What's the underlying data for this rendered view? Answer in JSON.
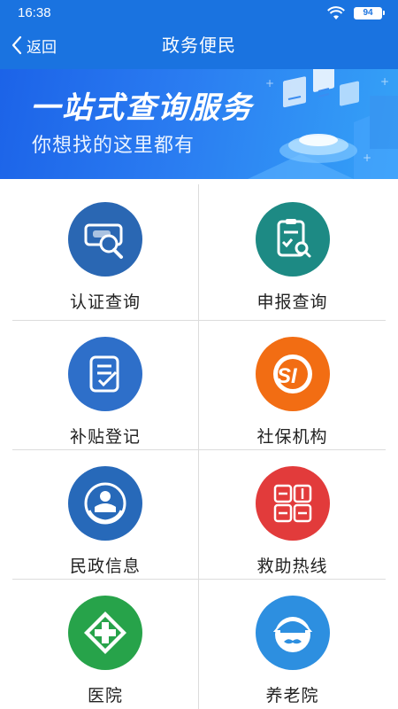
{
  "status_bar": {
    "time": "16:38",
    "battery": "94"
  },
  "nav": {
    "back_label": "返回",
    "title": "政务便民"
  },
  "banner": {
    "title": "一站式查询服务",
    "subtitle": "你想找的这里都有"
  },
  "services": [
    {
      "label": "认证查询",
      "icon": "search-id-icon",
      "color": "#2a67b3"
    },
    {
      "label": "申报查询",
      "icon": "clipboard-search-icon",
      "color": "#1d8a84"
    },
    {
      "label": "补贴登记",
      "icon": "document-check-icon",
      "color": "#2e6fc9"
    },
    {
      "label": "社保机构",
      "icon": "social-security-logo-icon",
      "color": "#f26d13"
    },
    {
      "label": "民政信息",
      "icon": "civil-affairs-emblem-icon",
      "color": "#2769b9"
    },
    {
      "label": "救助热线",
      "icon": "civil-affairs-seal-icon",
      "color": "#e23b3b"
    },
    {
      "label": "医院",
      "icon": "hospital-cross-icon",
      "color": "#27a34a"
    },
    {
      "label": "养老院",
      "icon": "elderly-face-icon",
      "color": "#2d8fe0"
    }
  ]
}
